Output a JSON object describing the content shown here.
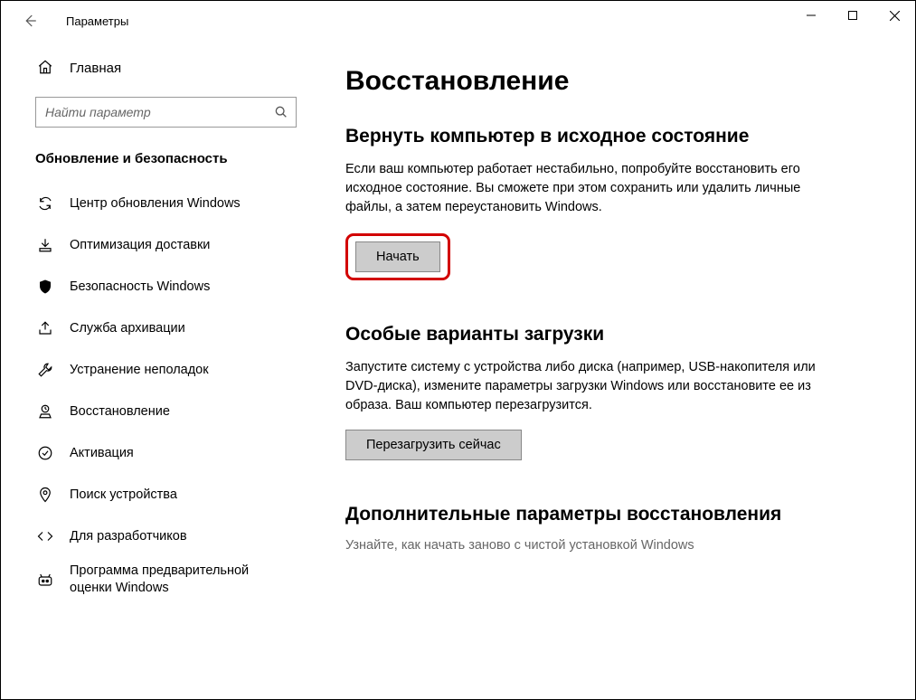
{
  "window": {
    "title": "Параметры"
  },
  "sidebar": {
    "home": "Главная",
    "search_placeholder": "Найти параметр",
    "section": "Обновление и безопасность",
    "items": [
      {
        "icon": "sync",
        "label": "Центр обновления Windows"
      },
      {
        "icon": "delivery",
        "label": "Оптимизация доставки"
      },
      {
        "icon": "shield",
        "label": "Безопасность Windows"
      },
      {
        "icon": "backup",
        "label": "Служба архивации"
      },
      {
        "icon": "trouble",
        "label": "Устранение неполадок"
      },
      {
        "icon": "recovery",
        "label": "Восстановление"
      },
      {
        "icon": "activation",
        "label": "Активация"
      },
      {
        "icon": "find",
        "label": "Поиск устройства"
      },
      {
        "icon": "dev",
        "label": "Для разработчиков"
      },
      {
        "icon": "insider",
        "label": "Программа предварительной оценки Windows"
      }
    ]
  },
  "main": {
    "title": "Восстановление",
    "reset": {
      "heading": "Вернуть компьютер в исходное состояние",
      "body": "Если ваш компьютер работает нестабильно, попробуйте восстановить его исходное состояние. Вы сможете при этом сохранить или удалить личные файлы, а затем переустановить Windows.",
      "button": "Начать"
    },
    "advanced_startup": {
      "heading": "Особые варианты загрузки",
      "body": "Запустите систему с устройства либо диска (например, USB-накопителя или DVD-диска), измените параметры загрузки Windows или восстановите ее из образа. Ваш компьютер перезагрузится.",
      "button": "Перезагрузить сейчас"
    },
    "more": {
      "heading": "Дополнительные параметры восстановления",
      "link": "Узнайте, как начать заново с чистой установкой Windows"
    }
  }
}
